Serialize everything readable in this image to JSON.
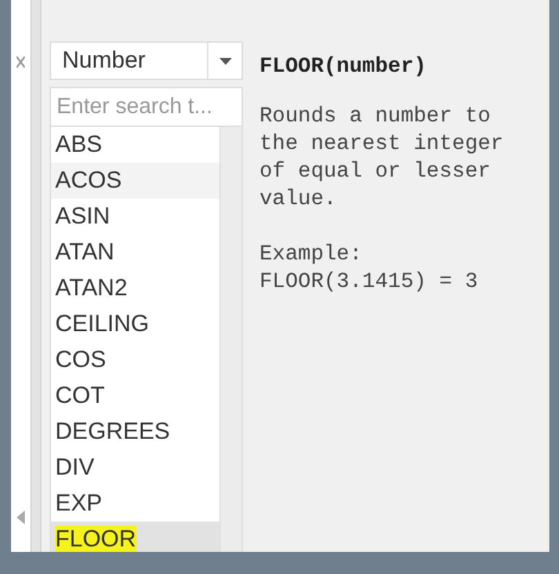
{
  "category_dropdown": {
    "value": "Number"
  },
  "search": {
    "placeholder": "Enter search t..."
  },
  "functions": [
    {
      "name": "ABS",
      "selected": false,
      "hovered": false,
      "marked": false
    },
    {
      "name": "ACOS",
      "selected": false,
      "hovered": true,
      "marked": false
    },
    {
      "name": "ASIN",
      "selected": false,
      "hovered": false,
      "marked": false
    },
    {
      "name": "ATAN",
      "selected": false,
      "hovered": false,
      "marked": false
    },
    {
      "name": "ATAN2",
      "selected": false,
      "hovered": false,
      "marked": false
    },
    {
      "name": "CEILING",
      "selected": false,
      "hovered": false,
      "marked": false
    },
    {
      "name": "COS",
      "selected": false,
      "hovered": false,
      "marked": false
    },
    {
      "name": "COT",
      "selected": false,
      "hovered": false,
      "marked": false
    },
    {
      "name": "DEGREES",
      "selected": false,
      "hovered": false,
      "marked": false
    },
    {
      "name": "DIV",
      "selected": false,
      "hovered": false,
      "marked": false
    },
    {
      "name": "EXP",
      "selected": false,
      "hovered": false,
      "marked": false
    },
    {
      "name": "FLOOR",
      "selected": true,
      "hovered": false,
      "marked": true
    }
  ],
  "help": {
    "signature": "FLOOR(number)",
    "description": "Rounds a number to the nearest integer of equal or lesser value.",
    "example_label": "Example:",
    "example": "FLOOR(3.1415) = 3"
  }
}
